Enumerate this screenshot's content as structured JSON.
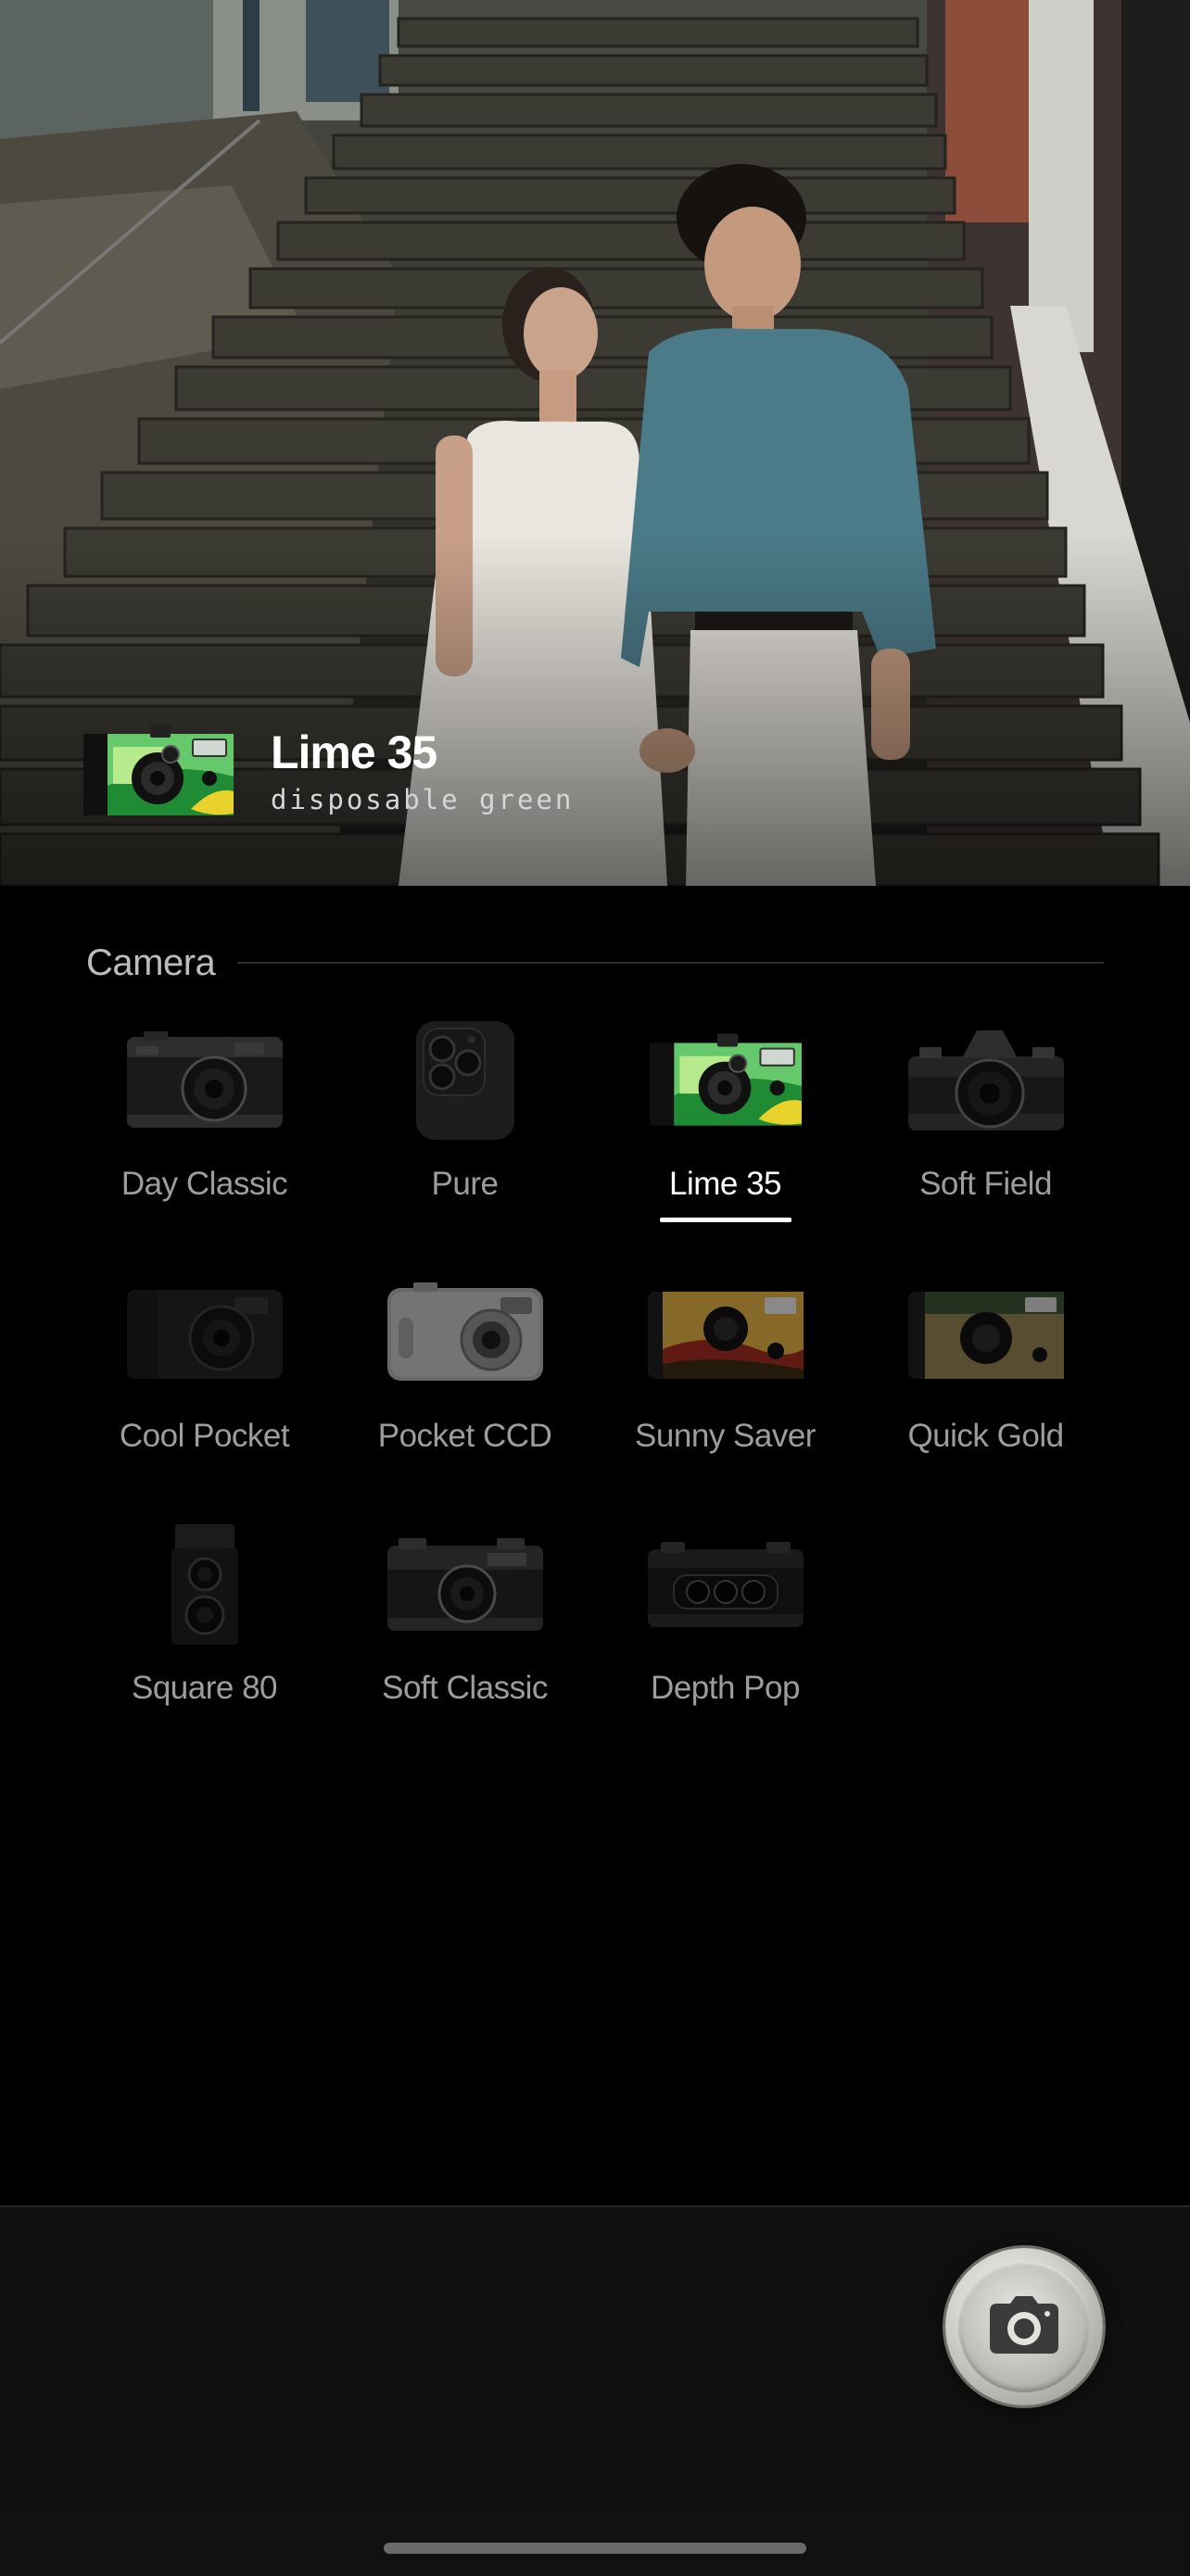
{
  "preview": {
    "photo": "couple-on-stairs-photo",
    "current_camera": {
      "name": "Lime 35",
      "description": "disposable green",
      "icon": "lime-35-camera-icon"
    }
  },
  "section": {
    "title": "Camera"
  },
  "cameras": [
    {
      "label": "Day Classic",
      "icon": "day-classic-camera-icon",
      "selected": false
    },
    {
      "label": "Pure",
      "icon": "pure-phone-camera-icon",
      "selected": false
    },
    {
      "label": "Lime 35",
      "icon": "lime-35-camera-icon",
      "selected": true
    },
    {
      "label": "Soft Field",
      "icon": "soft-field-slr-icon",
      "selected": false
    },
    {
      "label": "Cool Pocket",
      "icon": "cool-pocket-camera-icon",
      "selected": false
    },
    {
      "label": "Pocket CCD",
      "icon": "pocket-ccd-camera-icon",
      "selected": false
    },
    {
      "label": "Sunny Saver",
      "icon": "sunny-saver-camera-icon",
      "selected": false
    },
    {
      "label": "Quick Gold",
      "icon": "quick-gold-camera-icon",
      "selected": false
    },
    {
      "label": "Square 80",
      "icon": "square-80-tlr-icon",
      "selected": false
    },
    {
      "label": "Soft Classic",
      "icon": "soft-classic-rangefinder-icon",
      "selected": false
    },
    {
      "label": "Depth Pop",
      "icon": "depth-pop-3d-camera-icon",
      "selected": false
    }
  ],
  "shutter": {
    "icon": "camera-shutter-icon"
  },
  "colors": {
    "background": "#000000",
    "accent_green": "#3fb34a",
    "selected_label": "#ffffff",
    "unselected_label": "#9d9d9d"
  }
}
